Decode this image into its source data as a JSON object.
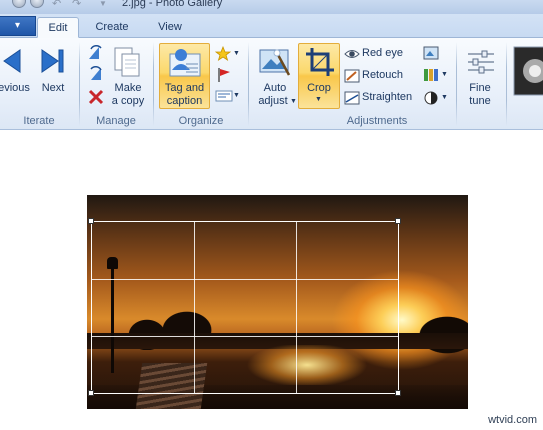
{
  "window": {
    "title": "2.jpg - Photo Gallery"
  },
  "file_tab": {
    "label": "▾"
  },
  "tabs": [
    {
      "label": "Edit",
      "active": true
    },
    {
      "label": "Create",
      "active": false
    },
    {
      "label": "View",
      "active": false
    }
  ],
  "groups": {
    "iterate": {
      "label": "Iterate",
      "previous": "evious",
      "next": "Next"
    },
    "manage": {
      "label": "Manage",
      "make_copy_line1": "Make",
      "make_copy_line2": "a copy"
    },
    "organize": {
      "label": "Organize",
      "tag_line1": "Tag and",
      "tag_line2": "caption"
    },
    "adjustments": {
      "label": "Adjustments",
      "auto_line1": "Auto",
      "auto_line2": "adjust",
      "crop": "Crop",
      "red_eye": "Red eye",
      "retouch": "Retouch",
      "straighten": "Straighten",
      "fine_line1": "Fine",
      "fine_line2": "tune"
    }
  },
  "colors": {
    "highlight": "#fbd86b",
    "accent": "#1f56a8",
    "ribbon_text": "#1e3961"
  },
  "watermark": "wtvid.com"
}
